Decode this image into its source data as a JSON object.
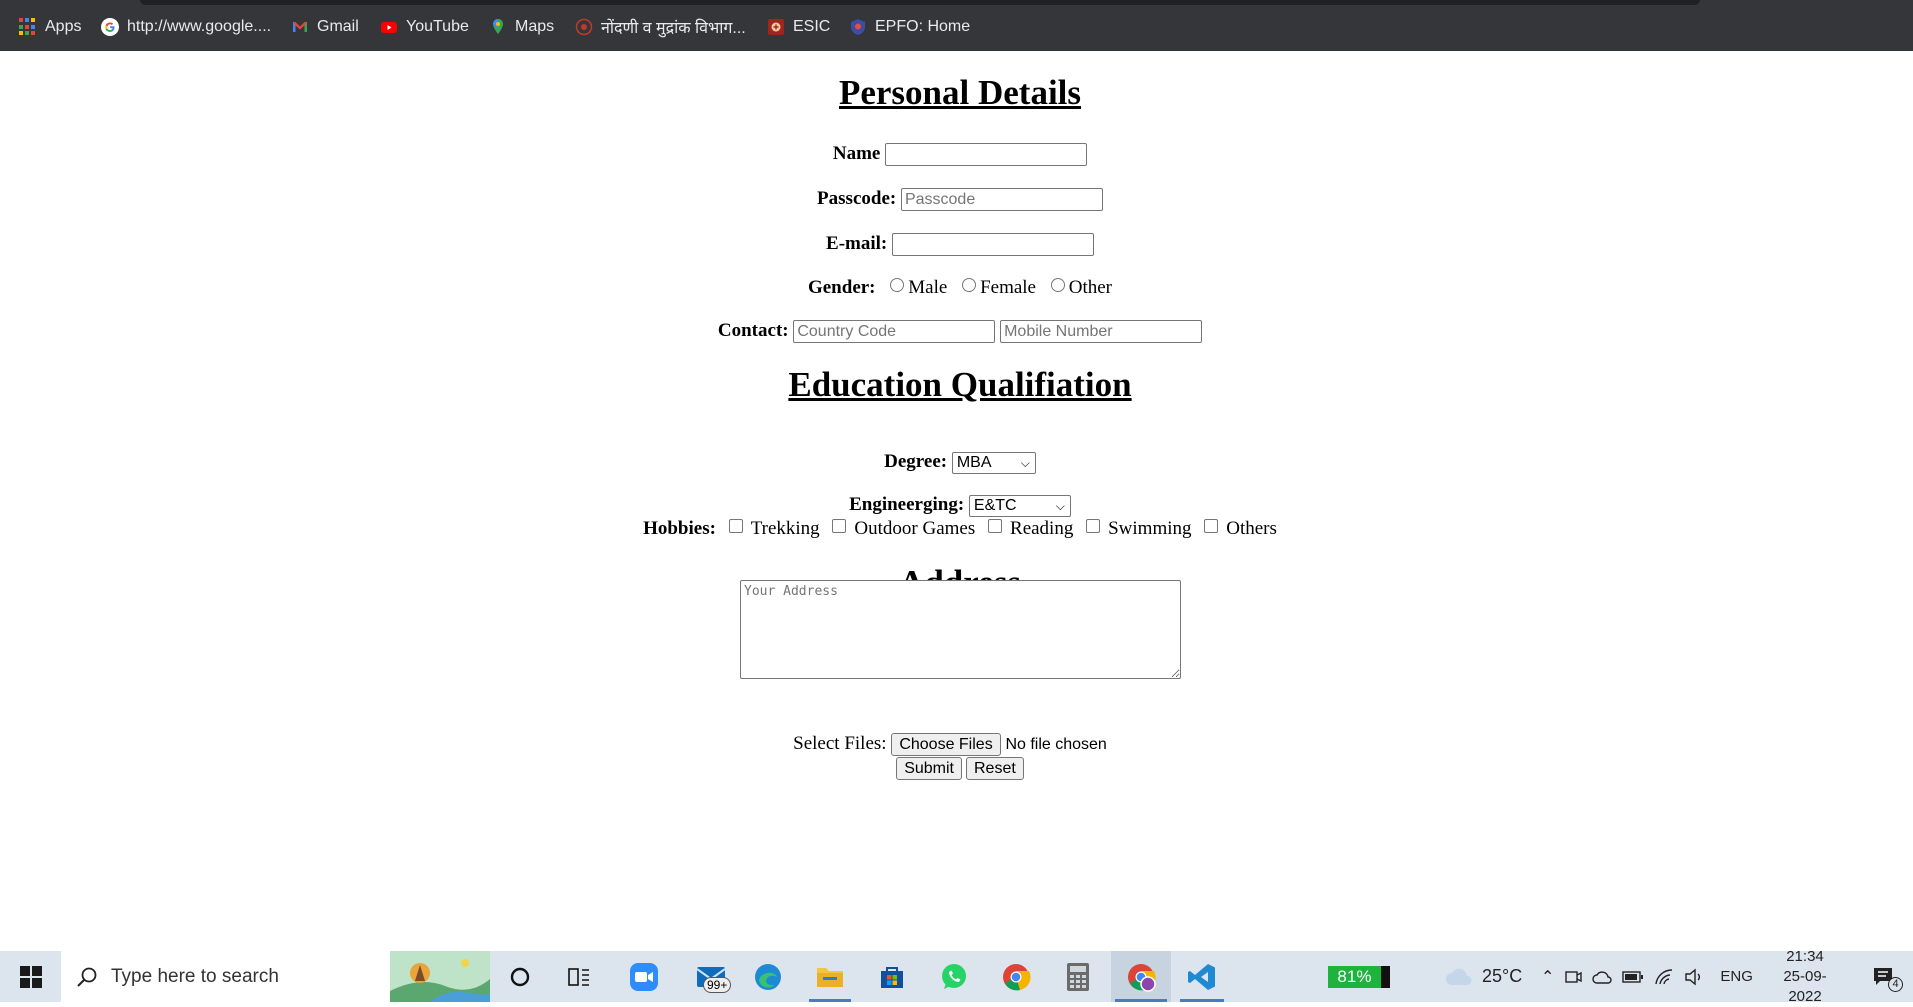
{
  "bookmarks": {
    "items": [
      {
        "label": "Apps",
        "icon": "apps-grid-icon"
      },
      {
        "label": "http://www.google....",
        "icon": "google-icon"
      },
      {
        "label": "Gmail",
        "icon": "gmail-icon"
      },
      {
        "label": "YouTube",
        "icon": "youtube-icon"
      },
      {
        "label": "Maps",
        "icon": "maps-icon"
      },
      {
        "label": "नोंदणी व मुद्रांक विभाग...",
        "icon": "emblem-icon"
      },
      {
        "label": "ESIC",
        "icon": "esic-icon"
      },
      {
        "label": "EPFO: Home",
        "icon": "epfo-icon"
      }
    ]
  },
  "personal": {
    "heading": "Personal Details",
    "name_label": "Name",
    "passcode_label": "Passcode:",
    "passcode_placeholder": "Passcode",
    "email_label": "E-mail:",
    "gender_label": "Gender:",
    "gender_options": [
      "Male",
      "Female",
      "Other"
    ],
    "contact_label": "Contact:",
    "country_code_placeholder": "Country Code",
    "mobile_placeholder": "Mobile Number"
  },
  "education": {
    "heading": "Education Qualifiation",
    "degree_label": "Degree:",
    "degree_value": "MBA",
    "engineering_label": "Engineerging:",
    "engineering_value": "E&TC",
    "hobbies_label": "Hobbies:",
    "hobbies": [
      "Trekking",
      "Outdoor Games",
      "Reading",
      "Swimming",
      "Others"
    ]
  },
  "address": {
    "heading": "Address",
    "placeholder": "Your Address",
    "files_label": "Select Files:",
    "choose_button": "Choose Files",
    "file_status": "No file chosen",
    "submit_label": "Submit",
    "reset_label": "Reset"
  },
  "taskbar": {
    "search_placeholder": "Type here to search",
    "mail_badge": "99+",
    "battery_percent": "81%",
    "temperature": "25°C",
    "language": "ENG",
    "time": "21:34",
    "date": "25-09-2022",
    "notification_count": "4"
  },
  "colors": {
    "bookmarks_bg": "#35363a",
    "taskbar_bg": "#dce4ee",
    "battery_green": "#1db33d"
  }
}
